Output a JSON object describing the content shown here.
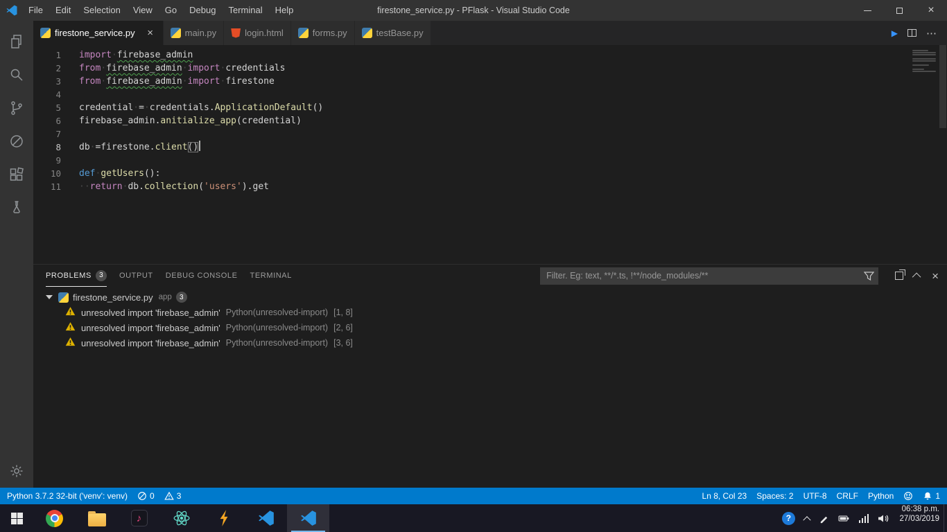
{
  "colors": {
    "accent": "#007acc",
    "editor_bg": "#1e1e1e",
    "titlebar_bg": "#333333",
    "warning": "#ddb100"
  },
  "title_bar": {
    "menus": [
      "File",
      "Edit",
      "Selection",
      "View",
      "Go",
      "Debug",
      "Terminal",
      "Help"
    ],
    "title": "firestone_service.py - PFlask - Visual Studio Code"
  },
  "activity_bar": {
    "items": [
      {
        "name": "explorer"
      },
      {
        "name": "search"
      },
      {
        "name": "source-control"
      },
      {
        "name": "debug"
      },
      {
        "name": "extensions"
      },
      {
        "name": "test"
      }
    ],
    "bottom": [
      {
        "name": "settings"
      }
    ]
  },
  "tab_bar": {
    "tabs": [
      {
        "label": "firestone_service.py",
        "icon": "python",
        "active": true,
        "close": "×"
      },
      {
        "label": "main.py",
        "icon": "python"
      },
      {
        "label": "login.html",
        "icon": "html"
      },
      {
        "label": "forms.py",
        "icon": "python"
      },
      {
        "label": "testBase.py",
        "icon": "python"
      }
    ],
    "actions": [
      {
        "name": "run",
        "glyph": "▶"
      },
      {
        "name": "split-editor"
      },
      {
        "name": "more-actions",
        "glyph": "⋯"
      }
    ]
  },
  "editor": {
    "cursor_line": 8,
    "lines": [
      {
        "num": 1,
        "tokens": [
          [
            "import",
            "kw"
          ],
          [
            "·",
            "ws"
          ],
          [
            "firebase_admin",
            "pl sq"
          ]
        ]
      },
      {
        "num": 2,
        "tokens": [
          [
            "from",
            "kw"
          ],
          [
            "·",
            "ws"
          ],
          [
            "firebase_admin",
            "pl sq"
          ],
          [
            "·",
            "ws"
          ],
          [
            "import",
            "kw"
          ],
          [
            "·",
            "ws"
          ],
          [
            "credentials",
            "pl"
          ]
        ]
      },
      {
        "num": 3,
        "tokens": [
          [
            "from",
            "kw"
          ],
          [
            "·",
            "ws"
          ],
          [
            "firebase_admin",
            "pl sq"
          ],
          [
            "·",
            "ws"
          ],
          [
            "import",
            "kw"
          ],
          [
            "·",
            "ws"
          ],
          [
            "firestone",
            "pl"
          ]
        ]
      },
      {
        "num": 4,
        "tokens": []
      },
      {
        "num": 5,
        "tokens": [
          [
            "credential",
            "pl"
          ],
          [
            "·",
            "ws"
          ],
          [
            "=",
            "pl"
          ],
          [
            "·",
            "ws"
          ],
          [
            "credentials.",
            "pl"
          ],
          [
            "ApplicationDefault",
            "fn"
          ],
          [
            "()",
            "pl"
          ]
        ]
      },
      {
        "num": 6,
        "tokens": [
          [
            "firebase_admin.",
            "pl"
          ],
          [
            "anitialize_app",
            "fn"
          ],
          [
            "(credential)",
            "pl"
          ]
        ]
      },
      {
        "num": 7,
        "tokens": []
      },
      {
        "num": 8,
        "tokens": [
          [
            "db",
            "pl"
          ],
          [
            "·",
            "ws"
          ],
          [
            "=firestone.",
            "pl"
          ],
          [
            "client",
            "fn"
          ],
          [
            "()",
            "pl brk"
          ]
        ]
      },
      {
        "num": 9,
        "tokens": []
      },
      {
        "num": 10,
        "tokens": [
          [
            "def",
            "def"
          ],
          [
            "·",
            "ws"
          ],
          [
            "getUsers",
            "fn"
          ],
          [
            "():",
            "pl"
          ]
        ]
      },
      {
        "num": 11,
        "tokens": [
          [
            "··",
            "ws"
          ],
          [
            "return",
            "kw"
          ],
          [
            "·",
            "ws"
          ],
          [
            "db.",
            "pl"
          ],
          [
            "collection",
            "fn"
          ],
          [
            "(",
            "pl"
          ],
          [
            "'users'",
            "str"
          ],
          [
            ")",
            "pl"
          ],
          [
            ".get",
            "pl"
          ]
        ]
      }
    ]
  },
  "panel": {
    "tabs": [
      {
        "label": "PROBLEMS",
        "badge": "3",
        "active": true
      },
      {
        "label": "OUTPUT"
      },
      {
        "label": "DEBUG CONSOLE"
      },
      {
        "label": "TERMINAL"
      }
    ],
    "filter_placeholder": "Filter. Eg: text, **/*.ts, !**/node_modules/**",
    "actions": [
      {
        "name": "restore-panel"
      },
      {
        "name": "maximize-panel"
      },
      {
        "name": "close-panel",
        "glyph": "×"
      }
    ]
  },
  "problems": {
    "group": {
      "file": "firestone_service.py",
      "scope": "app",
      "count": "3",
      "icon": "python"
    },
    "items": [
      {
        "severity": "warning",
        "message": "unresolved import 'firebase_admin'",
        "source": "Python(unresolved-import)",
        "position": "[1, 8]"
      },
      {
        "severity": "warning",
        "message": "unresolved import 'firebase_admin'",
        "source": "Python(unresolved-import)",
        "position": "[2, 6]"
      },
      {
        "severity": "warning",
        "message": "unresolved import 'firebase_admin'",
        "source": "Python(unresolved-import)",
        "position": "[3, 6]"
      }
    ]
  },
  "status_bar": {
    "left": [
      {
        "name": "python-interpreter",
        "label": "Python 3.7.2 32-bit ('venv': venv)"
      },
      {
        "name": "problems-errors",
        "icon": "error",
        "label": "0"
      },
      {
        "name": "problems-warnings",
        "icon": "warning",
        "label": "3"
      }
    ],
    "right": [
      {
        "name": "cursor-position",
        "label": "Ln 8, Col 23"
      },
      {
        "name": "indentation",
        "label": "Spaces: 2"
      },
      {
        "name": "encoding",
        "label": "UTF-8"
      },
      {
        "name": "eol",
        "label": "CRLF"
      },
      {
        "name": "language-mode",
        "label": "Python"
      },
      {
        "name": "feedback",
        "icon": "smiley",
        "label": ""
      },
      {
        "name": "notifications",
        "icon": "bell",
        "label": "1"
      }
    ]
  },
  "taskbar": {
    "apps": [
      {
        "name": "chrome"
      },
      {
        "name": "file-explorer"
      },
      {
        "name": "music"
      },
      {
        "name": "atom"
      },
      {
        "name": "lightning"
      },
      {
        "name": "vscode"
      },
      {
        "name": "vscode",
        "active": true
      }
    ],
    "tray": [
      {
        "name": "help"
      },
      {
        "name": "tray-expand"
      },
      {
        "name": "pen"
      },
      {
        "name": "battery"
      },
      {
        "name": "network"
      },
      {
        "name": "volume"
      }
    ],
    "clock": {
      "time": "06:38 p.m.",
      "date": "27/03/2019"
    }
  }
}
